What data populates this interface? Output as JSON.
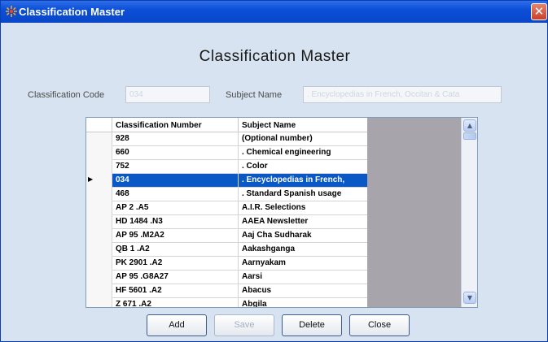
{
  "window": {
    "title": "Classification  Master",
    "close_glyph": "✕"
  },
  "form": {
    "heading": "Classification  Master",
    "code_label": "Classification Code",
    "code_value": "034",
    "subject_label": "Subject Name",
    "subject_value": ". Encyclopedias in French, Occitan & Cata"
  },
  "grid": {
    "columns": [
      "Classification Number",
      "Subject Name"
    ],
    "rows": [
      {
        "number": "928",
        "subject": "(Optional number)",
        "selected": false
      },
      {
        "number": "660",
        "subject": ". Chemical engineering",
        "selected": false
      },
      {
        "number": "752",
        "subject": ".  Color",
        "selected": false
      },
      {
        "number": "034",
        "subject": ". Encyclopedias in French,",
        "selected": true
      },
      {
        "number": "468",
        "subject": ". Standard Spanish usage",
        "selected": false
      },
      {
        "number": "AP 2 .A5",
        "subject": "A.I.R. Selections",
        "selected": false
      },
      {
        "number": "HD 1484 .N3",
        "subject": "AAEA Newsletter",
        "selected": false
      },
      {
        "number": "AP 95 .M2A2",
        "subject": "Aaj Cha Sudharak",
        "selected": false
      },
      {
        "number": "QB 1 .A2",
        "subject": "Aakashganga",
        "selected": false
      },
      {
        "number": "PK 2901 .A2",
        "subject": "Aarnyakam",
        "selected": false
      },
      {
        "number": "AP 95 .G8A27",
        "subject": "Aarsi",
        "selected": false
      },
      {
        "number": "HF 5601 .A2",
        "subject": "Abacus",
        "selected": false
      },
      {
        "number": "Z 671 .A2",
        "subject": "Abgila",
        "selected": false
      }
    ],
    "scroll_up_glyph": "▲",
    "scroll_down_glyph": "▼",
    "row_marker_glyph": "▶"
  },
  "buttons": {
    "add": "Add",
    "save": "Save",
    "delete": "Delete",
    "close": "Close"
  },
  "colors": {
    "selection": "#0a58c6",
    "titlebar": "#0b4fd8",
    "background": "#d7e3f1"
  }
}
